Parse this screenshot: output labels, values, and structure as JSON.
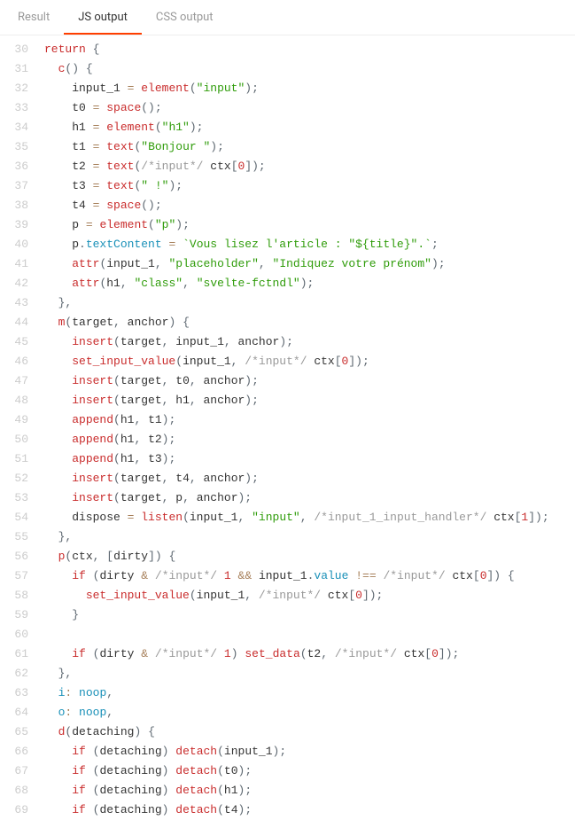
{
  "tabs": [
    {
      "label": "Result",
      "name": "tab-result"
    },
    {
      "label": "JS output",
      "name": "tab-js-output"
    },
    {
      "label": "CSS output",
      "name": "tab-css-output"
    }
  ],
  "activeTab": 1,
  "startLine": 30,
  "code": [
    [
      [
        "kw",
        "return"
      ],
      [
        "plain",
        " "
      ],
      [
        "punc",
        "{"
      ]
    ],
    [
      [
        "plain",
        "  "
      ],
      [
        "fn",
        "c"
      ],
      [
        "punc",
        "()"
      ],
      [
        "plain",
        " "
      ],
      [
        "punc",
        "{"
      ]
    ],
    [
      [
        "plain",
        "    input_1 "
      ],
      [
        "op",
        "="
      ],
      [
        "plain",
        " "
      ],
      [
        "fn",
        "element"
      ],
      [
        "punc",
        "("
      ],
      [
        "str",
        "\"input\""
      ],
      [
        "punc",
        ");"
      ]
    ],
    [
      [
        "plain",
        "    t0 "
      ],
      [
        "op",
        "="
      ],
      [
        "plain",
        " "
      ],
      [
        "fn",
        "space"
      ],
      [
        "punc",
        "();"
      ]
    ],
    [
      [
        "plain",
        "    h1 "
      ],
      [
        "op",
        "="
      ],
      [
        "plain",
        " "
      ],
      [
        "fn",
        "element"
      ],
      [
        "punc",
        "("
      ],
      [
        "str",
        "\"h1\""
      ],
      [
        "punc",
        ");"
      ]
    ],
    [
      [
        "plain",
        "    t1 "
      ],
      [
        "op",
        "="
      ],
      [
        "plain",
        " "
      ],
      [
        "fn",
        "text"
      ],
      [
        "punc",
        "("
      ],
      [
        "str",
        "\"Bonjour \""
      ],
      [
        "punc",
        ");"
      ]
    ],
    [
      [
        "plain",
        "    t2 "
      ],
      [
        "op",
        "="
      ],
      [
        "plain",
        " "
      ],
      [
        "fn",
        "text"
      ],
      [
        "punc",
        "("
      ],
      [
        "cmt",
        "/*input*/"
      ],
      [
        "plain",
        " ctx"
      ],
      [
        "punc",
        "["
      ],
      [
        "num",
        "0"
      ],
      [
        "punc",
        "]);"
      ]
    ],
    [
      [
        "plain",
        "    t3 "
      ],
      [
        "op",
        "="
      ],
      [
        "plain",
        " "
      ],
      [
        "fn",
        "text"
      ],
      [
        "punc",
        "("
      ],
      [
        "str",
        "\" !\""
      ],
      [
        "punc",
        ");"
      ]
    ],
    [
      [
        "plain",
        "    t4 "
      ],
      [
        "op",
        "="
      ],
      [
        "plain",
        " "
      ],
      [
        "fn",
        "space"
      ],
      [
        "punc",
        "();"
      ]
    ],
    [
      [
        "plain",
        "    p "
      ],
      [
        "op",
        "="
      ],
      [
        "plain",
        " "
      ],
      [
        "fn",
        "element"
      ],
      [
        "punc",
        "("
      ],
      [
        "str",
        "\"p\""
      ],
      [
        "punc",
        ");"
      ]
    ],
    [
      [
        "plain",
        "    p"
      ],
      [
        "punc",
        "."
      ],
      [
        "prop",
        "textContent"
      ],
      [
        "plain",
        " "
      ],
      [
        "op",
        "="
      ],
      [
        "plain",
        " "
      ],
      [
        "tstr",
        "`Vous lisez l'article : \"${title}\".`"
      ],
      [
        "punc",
        ";"
      ]
    ],
    [
      [
        "plain",
        "    "
      ],
      [
        "fn",
        "attr"
      ],
      [
        "punc",
        "("
      ],
      [
        "plain",
        "input_1"
      ],
      [
        "punc",
        ","
      ],
      [
        "plain",
        " "
      ],
      [
        "str",
        "\"placeholder\""
      ],
      [
        "punc",
        ","
      ],
      [
        "plain",
        " "
      ],
      [
        "str",
        "\"Indiquez votre prénom\""
      ],
      [
        "punc",
        ");"
      ]
    ],
    [
      [
        "plain",
        "    "
      ],
      [
        "fn",
        "attr"
      ],
      [
        "punc",
        "("
      ],
      [
        "plain",
        "h1"
      ],
      [
        "punc",
        ","
      ],
      [
        "plain",
        " "
      ],
      [
        "str",
        "\"class\""
      ],
      [
        "punc",
        ","
      ],
      [
        "plain",
        " "
      ],
      [
        "str",
        "\"svelte-fctndl\""
      ],
      [
        "punc",
        ");"
      ]
    ],
    [
      [
        "plain",
        "  "
      ],
      [
        "punc",
        "},"
      ]
    ],
    [
      [
        "plain",
        "  "
      ],
      [
        "fn",
        "m"
      ],
      [
        "punc",
        "("
      ],
      [
        "plain",
        "target"
      ],
      [
        "punc",
        ","
      ],
      [
        "plain",
        " anchor"
      ],
      [
        "punc",
        ")"
      ],
      [
        "plain",
        " "
      ],
      [
        "punc",
        "{"
      ]
    ],
    [
      [
        "plain",
        "    "
      ],
      [
        "fn",
        "insert"
      ],
      [
        "punc",
        "("
      ],
      [
        "plain",
        "target"
      ],
      [
        "punc",
        ","
      ],
      [
        "plain",
        " input_1"
      ],
      [
        "punc",
        ","
      ],
      [
        "plain",
        " anchor"
      ],
      [
        "punc",
        ");"
      ]
    ],
    [
      [
        "plain",
        "    "
      ],
      [
        "fn",
        "set_input_value"
      ],
      [
        "punc",
        "("
      ],
      [
        "plain",
        "input_1"
      ],
      [
        "punc",
        ","
      ],
      [
        "plain",
        " "
      ],
      [
        "cmt",
        "/*input*/"
      ],
      [
        "plain",
        " ctx"
      ],
      [
        "punc",
        "["
      ],
      [
        "num",
        "0"
      ],
      [
        "punc",
        "]);"
      ]
    ],
    [
      [
        "plain",
        "    "
      ],
      [
        "fn",
        "insert"
      ],
      [
        "punc",
        "("
      ],
      [
        "plain",
        "target"
      ],
      [
        "punc",
        ","
      ],
      [
        "plain",
        " t0"
      ],
      [
        "punc",
        ","
      ],
      [
        "plain",
        " anchor"
      ],
      [
        "punc",
        ");"
      ]
    ],
    [
      [
        "plain",
        "    "
      ],
      [
        "fn",
        "insert"
      ],
      [
        "punc",
        "("
      ],
      [
        "plain",
        "target"
      ],
      [
        "punc",
        ","
      ],
      [
        "plain",
        " h1"
      ],
      [
        "punc",
        ","
      ],
      [
        "plain",
        " anchor"
      ],
      [
        "punc",
        ");"
      ]
    ],
    [
      [
        "plain",
        "    "
      ],
      [
        "fn",
        "append"
      ],
      [
        "punc",
        "("
      ],
      [
        "plain",
        "h1"
      ],
      [
        "punc",
        ","
      ],
      [
        "plain",
        " t1"
      ],
      [
        "punc",
        ");"
      ]
    ],
    [
      [
        "plain",
        "    "
      ],
      [
        "fn",
        "append"
      ],
      [
        "punc",
        "("
      ],
      [
        "plain",
        "h1"
      ],
      [
        "punc",
        ","
      ],
      [
        "plain",
        " t2"
      ],
      [
        "punc",
        ");"
      ]
    ],
    [
      [
        "plain",
        "    "
      ],
      [
        "fn",
        "append"
      ],
      [
        "punc",
        "("
      ],
      [
        "plain",
        "h1"
      ],
      [
        "punc",
        ","
      ],
      [
        "plain",
        " t3"
      ],
      [
        "punc",
        ");"
      ]
    ],
    [
      [
        "plain",
        "    "
      ],
      [
        "fn",
        "insert"
      ],
      [
        "punc",
        "("
      ],
      [
        "plain",
        "target"
      ],
      [
        "punc",
        ","
      ],
      [
        "plain",
        " t4"
      ],
      [
        "punc",
        ","
      ],
      [
        "plain",
        " anchor"
      ],
      [
        "punc",
        ");"
      ]
    ],
    [
      [
        "plain",
        "    "
      ],
      [
        "fn",
        "insert"
      ],
      [
        "punc",
        "("
      ],
      [
        "plain",
        "target"
      ],
      [
        "punc",
        ","
      ],
      [
        "plain",
        " p"
      ],
      [
        "punc",
        ","
      ],
      [
        "plain",
        " anchor"
      ],
      [
        "punc",
        ");"
      ]
    ],
    [
      [
        "plain",
        "    dispose "
      ],
      [
        "op",
        "="
      ],
      [
        "plain",
        " "
      ],
      [
        "fn",
        "listen"
      ],
      [
        "punc",
        "("
      ],
      [
        "plain",
        "input_1"
      ],
      [
        "punc",
        ","
      ],
      [
        "plain",
        " "
      ],
      [
        "str",
        "\"input\""
      ],
      [
        "punc",
        ","
      ],
      [
        "plain",
        " "
      ],
      [
        "cmt",
        "/*input_1_input_handler*/"
      ],
      [
        "plain",
        " ctx"
      ],
      [
        "punc",
        "["
      ],
      [
        "num",
        "1"
      ],
      [
        "punc",
        "]);"
      ]
    ],
    [
      [
        "plain",
        "  "
      ],
      [
        "punc",
        "},"
      ]
    ],
    [
      [
        "plain",
        "  "
      ],
      [
        "fn",
        "p"
      ],
      [
        "punc",
        "("
      ],
      [
        "plain",
        "ctx"
      ],
      [
        "punc",
        ","
      ],
      [
        "plain",
        " "
      ],
      [
        "punc",
        "["
      ],
      [
        "plain",
        "dirty"
      ],
      [
        "punc",
        "])"
      ],
      [
        "plain",
        " "
      ],
      [
        "punc",
        "{"
      ]
    ],
    [
      [
        "plain",
        "    "
      ],
      [
        "kw",
        "if"
      ],
      [
        "plain",
        " "
      ],
      [
        "punc",
        "("
      ],
      [
        "plain",
        "dirty "
      ],
      [
        "op",
        "&"
      ],
      [
        "plain",
        " "
      ],
      [
        "cmt",
        "/*input*/"
      ],
      [
        "plain",
        " "
      ],
      [
        "num",
        "1"
      ],
      [
        "plain",
        " "
      ],
      [
        "op",
        "&&"
      ],
      [
        "plain",
        " input_1"
      ],
      [
        "punc",
        "."
      ],
      [
        "prop",
        "value"
      ],
      [
        "plain",
        " "
      ],
      [
        "op",
        "!=="
      ],
      [
        "plain",
        " "
      ],
      [
        "cmt",
        "/*input*/"
      ],
      [
        "plain",
        " ctx"
      ],
      [
        "punc",
        "["
      ],
      [
        "num",
        "0"
      ],
      [
        "punc",
        "])"
      ],
      [
        "plain",
        " "
      ],
      [
        "punc",
        "{"
      ]
    ],
    [
      [
        "plain",
        "      "
      ],
      [
        "fn",
        "set_input_value"
      ],
      [
        "punc",
        "("
      ],
      [
        "plain",
        "input_1"
      ],
      [
        "punc",
        ","
      ],
      [
        "plain",
        " "
      ],
      [
        "cmt",
        "/*input*/"
      ],
      [
        "plain",
        " ctx"
      ],
      [
        "punc",
        "["
      ],
      [
        "num",
        "0"
      ],
      [
        "punc",
        "]);"
      ]
    ],
    [
      [
        "plain",
        "    "
      ],
      [
        "punc",
        "}"
      ]
    ],
    [],
    [
      [
        "plain",
        "    "
      ],
      [
        "kw",
        "if"
      ],
      [
        "plain",
        " "
      ],
      [
        "punc",
        "("
      ],
      [
        "plain",
        "dirty "
      ],
      [
        "op",
        "&"
      ],
      [
        "plain",
        " "
      ],
      [
        "cmt",
        "/*input*/"
      ],
      [
        "plain",
        " "
      ],
      [
        "num",
        "1"
      ],
      [
        "punc",
        ")"
      ],
      [
        "plain",
        " "
      ],
      [
        "fn",
        "set_data"
      ],
      [
        "punc",
        "("
      ],
      [
        "plain",
        "t2"
      ],
      [
        "punc",
        ","
      ],
      [
        "plain",
        " "
      ],
      [
        "cmt",
        "/*input*/"
      ],
      [
        "plain",
        " ctx"
      ],
      [
        "punc",
        "["
      ],
      [
        "num",
        "0"
      ],
      [
        "punc",
        "]);"
      ]
    ],
    [
      [
        "plain",
        "  "
      ],
      [
        "punc",
        "},"
      ]
    ],
    [
      [
        "plain",
        "  "
      ],
      [
        "prop",
        "i"
      ],
      [
        "op",
        ":"
      ],
      [
        "plain",
        " "
      ],
      [
        "glob",
        "noop"
      ],
      [
        "punc",
        ","
      ]
    ],
    [
      [
        "plain",
        "  "
      ],
      [
        "prop",
        "o"
      ],
      [
        "op",
        ":"
      ],
      [
        "plain",
        " "
      ],
      [
        "glob",
        "noop"
      ],
      [
        "punc",
        ","
      ]
    ],
    [
      [
        "plain",
        "  "
      ],
      [
        "fn",
        "d"
      ],
      [
        "punc",
        "("
      ],
      [
        "plain",
        "detaching"
      ],
      [
        "punc",
        ")"
      ],
      [
        "plain",
        " "
      ],
      [
        "punc",
        "{"
      ]
    ],
    [
      [
        "plain",
        "    "
      ],
      [
        "kw",
        "if"
      ],
      [
        "plain",
        " "
      ],
      [
        "punc",
        "("
      ],
      [
        "plain",
        "detaching"
      ],
      [
        "punc",
        ")"
      ],
      [
        "plain",
        " "
      ],
      [
        "fn",
        "detach"
      ],
      [
        "punc",
        "("
      ],
      [
        "plain",
        "input_1"
      ],
      [
        "punc",
        ");"
      ]
    ],
    [
      [
        "plain",
        "    "
      ],
      [
        "kw",
        "if"
      ],
      [
        "plain",
        " "
      ],
      [
        "punc",
        "("
      ],
      [
        "plain",
        "detaching"
      ],
      [
        "punc",
        ")"
      ],
      [
        "plain",
        " "
      ],
      [
        "fn",
        "detach"
      ],
      [
        "punc",
        "("
      ],
      [
        "plain",
        "t0"
      ],
      [
        "punc",
        ");"
      ]
    ],
    [
      [
        "plain",
        "    "
      ],
      [
        "kw",
        "if"
      ],
      [
        "plain",
        " "
      ],
      [
        "punc",
        "("
      ],
      [
        "plain",
        "detaching"
      ],
      [
        "punc",
        ")"
      ],
      [
        "plain",
        " "
      ],
      [
        "fn",
        "detach"
      ],
      [
        "punc",
        "("
      ],
      [
        "plain",
        "h1"
      ],
      [
        "punc",
        ");"
      ]
    ],
    [
      [
        "plain",
        "    "
      ],
      [
        "kw",
        "if"
      ],
      [
        "plain",
        " "
      ],
      [
        "punc",
        "("
      ],
      [
        "plain",
        "detaching"
      ],
      [
        "punc",
        ")"
      ],
      [
        "plain",
        " "
      ],
      [
        "fn",
        "detach"
      ],
      [
        "punc",
        "("
      ],
      [
        "plain",
        "t4"
      ],
      [
        "punc",
        ");"
      ]
    ]
  ]
}
